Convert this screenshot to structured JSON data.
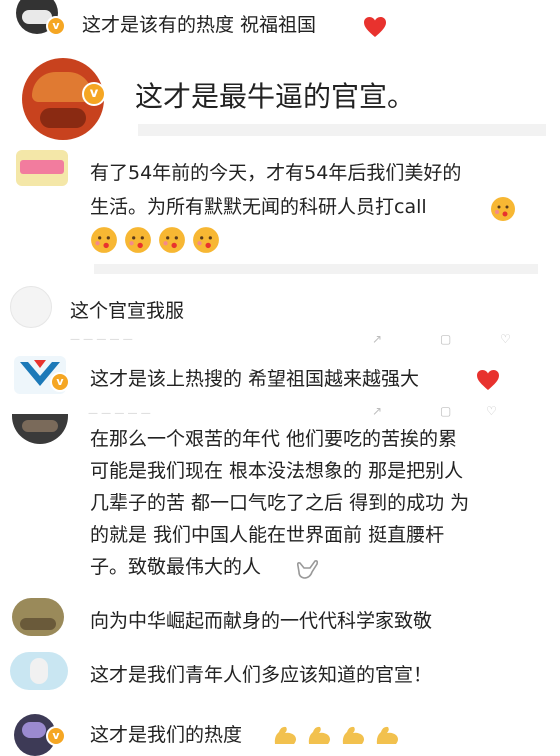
{
  "comments": [
    {
      "text": "这才是该有的热度 祝福祖国"
    },
    {
      "text": "这才是最牛逼的官宣。"
    },
    {
      "lines": [
        "有了54年前的今天，才有54年后我们美好的",
        "生活。为所有默默无闻的科研人员打call"
      ]
    },
    {
      "text": "这个官宣我服"
    },
    {
      "text": "这才是该上热搜的 希望祖国越来越强大"
    },
    {
      "lines": [
        "在那么一个艰苦的年代 他们要吃的苦挨的累",
        "可能是我们现在 根本没法想象的 那是把别人",
        "几辈子的苦 都一口气吃了之后 得到的成功 为",
        "的就是 我们中国人能在世界面前 挺直腰杆",
        "子。致敬最伟大的人"
      ]
    },
    {
      "text": "向为中华崛起而献身的一代代科学家致敬"
    },
    {
      "text": "这才是我们青年人们多应该知道的官宣！"
    },
    {
      "text": "这才是我们的热度"
    }
  ],
  "icons": {
    "verified": "verified-icon",
    "heart": "heart-icon",
    "kiss": "kiss-emoji-icon",
    "hand": "shaka-hand-icon",
    "muscle": "flexed-biceps-icon",
    "share": "share-icon",
    "comment": "comment-icon",
    "like": "like-icon"
  },
  "colors": {
    "heart": "#e8322e",
    "verified": "#f5a623",
    "kiss_face": "#f7b733",
    "muscle": "#f2c14e"
  }
}
